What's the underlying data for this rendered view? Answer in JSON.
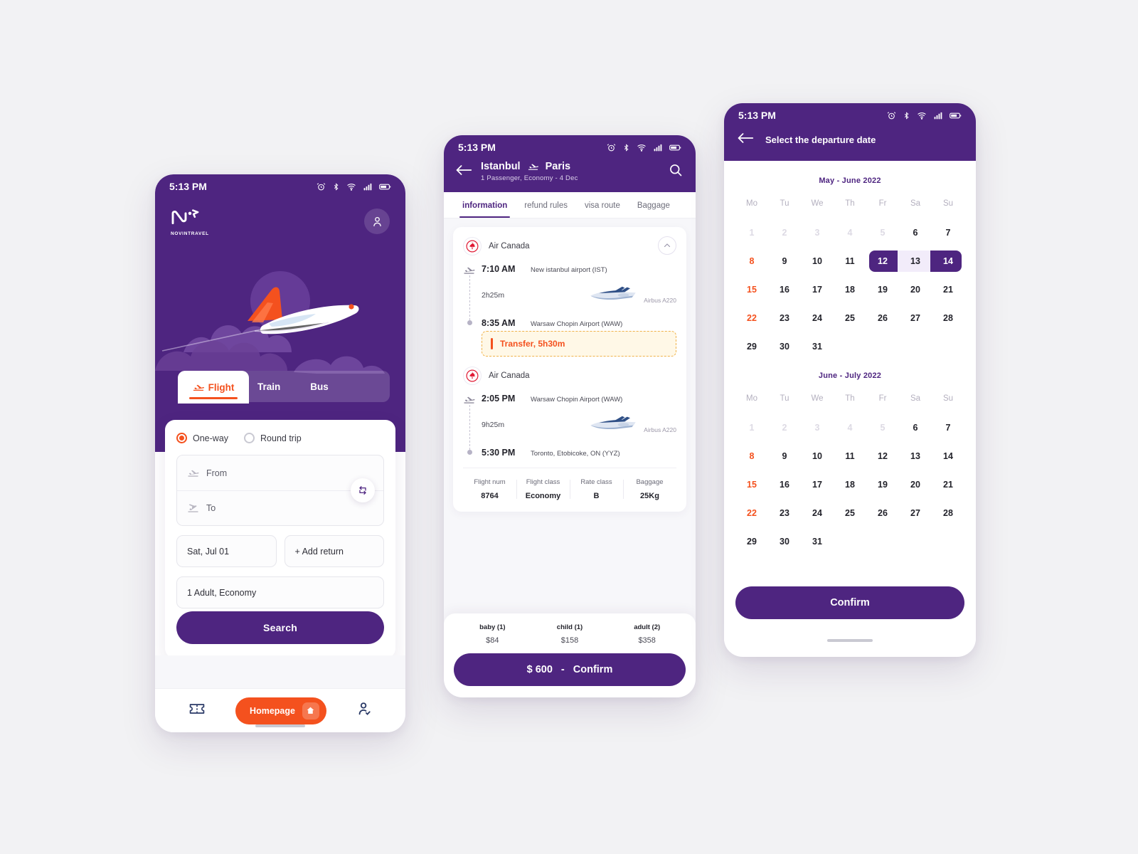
{
  "theme": {
    "purple": "#4e2580",
    "orange": "#f4511e",
    "page_bg": "#f2f2f4",
    "range_light": "#f2ecfa"
  },
  "phone1": {
    "status": {
      "time": "5:13 PM",
      "icons": [
        "alarm-icon",
        "bluetooth-icon",
        "wifi-icon",
        "signal-icon",
        "battery-icon"
      ]
    },
    "brand": {
      "name": "NOVINTRAVEL"
    },
    "tabs": [
      {
        "label": "Flight",
        "active": true
      },
      {
        "label": "Train",
        "active": false
      },
      {
        "label": "Bus",
        "active": false
      }
    ],
    "trip_types": [
      {
        "label": "One-way",
        "selected": true
      },
      {
        "label": "Round trip",
        "selected": false
      }
    ],
    "fields": {
      "from_placeholder": "From",
      "to_placeholder": "To",
      "date_value": "Sat, Jul 01",
      "return_value": "+ Add return",
      "pax_value": "1 Adult, Economy"
    },
    "search_label": "Search",
    "bottom_nav": {
      "ticket_icon": "ticket-icon",
      "home_label": "Homepage",
      "home_icon": "house-icon",
      "profile_icon": "user-check-icon"
    }
  },
  "phone2": {
    "status": {
      "time": "5:13 PM"
    },
    "header": {
      "back_icon": "arrow-left-icon",
      "origin": "Istanbul",
      "destination": "Paris",
      "route_icon": "plane-takeoff-icon",
      "subtitle": "1 Passenger, Economy  -   4 Dec",
      "search_icon": "search-icon"
    },
    "tabs": [
      {
        "label": "information",
        "active": true
      },
      {
        "label": "refund rules",
        "active": false
      },
      {
        "label": "visa route",
        "active": false
      },
      {
        "label": "Baggage",
        "active": false
      }
    ],
    "legs": [
      {
        "airline": "Air Canada",
        "depart_time": "7:10 AM",
        "depart_place": "New istanbul airport (IST)",
        "duration": "2h25m",
        "aircraft": "Airbus A220",
        "arrive_time": "8:35 AM",
        "arrive_place": "Warsaw Chopin Airport (WAW)"
      },
      {
        "airline": "Air Canada",
        "depart_time": "2:05 PM",
        "depart_place": "Warsaw Chopin Airport (WAW)",
        "duration": "9h25m",
        "aircraft": "Airbus A220",
        "arrive_time": "5:30 PM",
        "arrive_place": "Toronto, Etobicoke, ON (YYZ)"
      }
    ],
    "transfer": {
      "label": "Transfer, 5h30m"
    },
    "meta": [
      {
        "key": "Flight num",
        "value": "8764"
      },
      {
        "key": "Flight class",
        "value": "Economy"
      },
      {
        "key": "Rate class",
        "value": "B"
      },
      {
        "key": "Baggage",
        "value": "25Kg"
      }
    ],
    "passengers": [
      {
        "key": "baby (1)",
        "value": "$84"
      },
      {
        "key": "child (1)",
        "value": "$158"
      },
      {
        "key": "adult (2)",
        "value": "$358"
      }
    ],
    "confirm": {
      "price": "$ 600",
      "dash": "-",
      "label": "Confirm"
    }
  },
  "phone3": {
    "status": {
      "time": "5:13 PM"
    },
    "header": {
      "back_icon": "arrow-left-icon",
      "title": "Select the departure date"
    },
    "dow": [
      "Mo",
      "Tu",
      "We",
      "Th",
      "Fr",
      "Sa",
      "Su"
    ],
    "months": [
      {
        "title": "May - June 2022",
        "weeks": [
          [
            {
              "n": "1",
              "s": "dim"
            },
            {
              "n": "2",
              "s": "dim"
            },
            {
              "n": "3",
              "s": "dim"
            },
            {
              "n": "4",
              "s": "dim"
            },
            {
              "n": "5",
              "s": "dim"
            },
            {
              "n": "6",
              "s": ""
            },
            {
              "n": "7",
              "s": ""
            }
          ],
          [
            {
              "n": "8",
              "s": "red"
            },
            {
              "n": "9",
              "s": ""
            },
            {
              "n": "10",
              "s": ""
            },
            {
              "n": "11",
              "s": ""
            },
            {
              "n": "12",
              "s": "sel-start"
            },
            {
              "n": "13",
              "s": "sel-mid"
            },
            {
              "n": "14",
              "s": "sel-end"
            }
          ],
          [
            {
              "n": "15",
              "s": "red"
            },
            {
              "n": "16",
              "s": ""
            },
            {
              "n": "17",
              "s": ""
            },
            {
              "n": "18",
              "s": ""
            },
            {
              "n": "19",
              "s": ""
            },
            {
              "n": "20",
              "s": ""
            },
            {
              "n": "21",
              "s": ""
            }
          ],
          [
            {
              "n": "22",
              "s": "red"
            },
            {
              "n": "23",
              "s": ""
            },
            {
              "n": "24",
              "s": ""
            },
            {
              "n": "25",
              "s": ""
            },
            {
              "n": "26",
              "s": ""
            },
            {
              "n": "27",
              "s": ""
            },
            {
              "n": "28",
              "s": ""
            }
          ],
          [
            {
              "n": "29",
              "s": ""
            },
            {
              "n": "30",
              "s": ""
            },
            {
              "n": "31",
              "s": ""
            },
            {
              "n": "",
              "s": "empty"
            },
            {
              "n": "",
              "s": "empty"
            },
            {
              "n": "",
              "s": "empty"
            },
            {
              "n": "",
              "s": "empty"
            }
          ]
        ]
      },
      {
        "title": "June - July 2022",
        "weeks": [
          [
            {
              "n": "1",
              "s": "dim"
            },
            {
              "n": "2",
              "s": "dim"
            },
            {
              "n": "3",
              "s": "dim"
            },
            {
              "n": "4",
              "s": "dim"
            },
            {
              "n": "5",
              "s": "dim"
            },
            {
              "n": "6",
              "s": ""
            },
            {
              "n": "7",
              "s": ""
            }
          ],
          [
            {
              "n": "8",
              "s": "red"
            },
            {
              "n": "9",
              "s": ""
            },
            {
              "n": "10",
              "s": ""
            },
            {
              "n": "11",
              "s": ""
            },
            {
              "n": "12",
              "s": ""
            },
            {
              "n": "13",
              "s": ""
            },
            {
              "n": "14",
              "s": ""
            }
          ],
          [
            {
              "n": "15",
              "s": "red"
            },
            {
              "n": "16",
              "s": ""
            },
            {
              "n": "17",
              "s": ""
            },
            {
              "n": "18",
              "s": ""
            },
            {
              "n": "19",
              "s": ""
            },
            {
              "n": "20",
              "s": ""
            },
            {
              "n": "21",
              "s": ""
            }
          ],
          [
            {
              "n": "22",
              "s": "red"
            },
            {
              "n": "23",
              "s": ""
            },
            {
              "n": "24",
              "s": ""
            },
            {
              "n": "25",
              "s": ""
            },
            {
              "n": "26",
              "s": ""
            },
            {
              "n": "27",
              "s": ""
            },
            {
              "n": "28",
              "s": ""
            }
          ],
          [
            {
              "n": "29",
              "s": ""
            },
            {
              "n": "30",
              "s": ""
            },
            {
              "n": "31",
              "s": ""
            },
            {
              "n": "",
              "s": "empty"
            },
            {
              "n": "",
              "s": "empty"
            },
            {
              "n": "",
              "s": "empty"
            },
            {
              "n": "",
              "s": "empty"
            }
          ]
        ]
      }
    ],
    "confirm_label": "Confirm"
  }
}
